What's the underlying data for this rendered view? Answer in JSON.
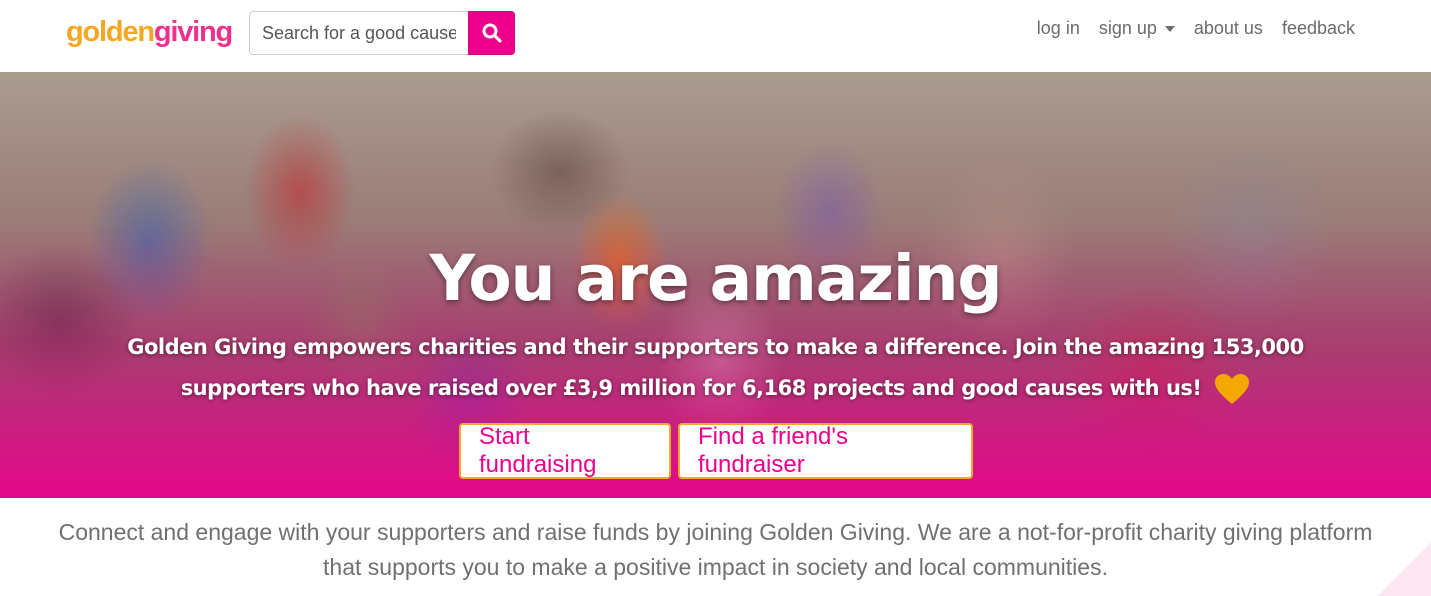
{
  "brand": {
    "logo_part1": "golden",
    "logo_part2": "giving",
    "color_pink": "#ec008c",
    "color_gold": "#f5a623"
  },
  "search": {
    "placeholder": "Search for a good cause",
    "icon": "search-icon"
  },
  "nav": {
    "login": "log in",
    "signup": "sign up",
    "about": "about us",
    "feedback": "feedback"
  },
  "hero": {
    "title": "You are amazing",
    "subtitle": "Golden Giving empowers charities and their supporters to make a difference. Join the amazing 153,000 supporters who have raised over £3,9 million for 6,168 projects and good causes with us!",
    "heart_icon": "heart-icon",
    "start_button": "Start fundraising",
    "find_button": "Find a friend's fundraiser"
  },
  "intro": {
    "text": "Connect and engage with your supporters and raise funds by joining Golden Giving. We are a not-for-profit charity giving platform that supports you to make a positive impact in society and local communities."
  }
}
